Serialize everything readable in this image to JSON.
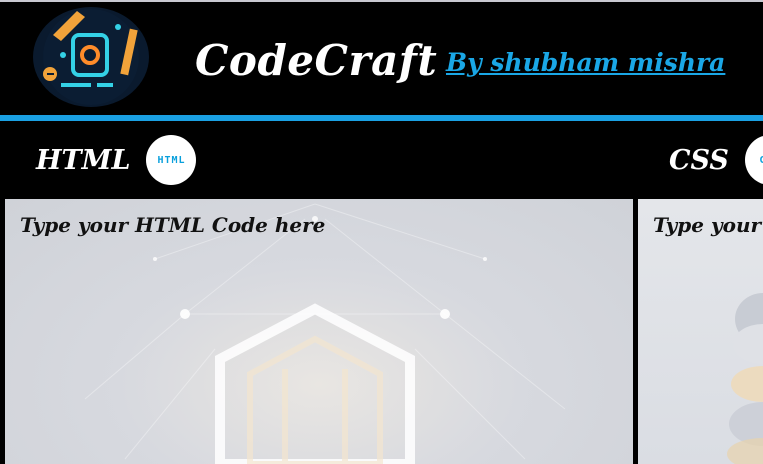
{
  "header": {
    "brand": "CodeCraft",
    "byline": "By shubham mishra"
  },
  "panels": {
    "html": {
      "label": "HTML",
      "badge": "HTML",
      "placeholder": "Type your HTML Code here"
    },
    "css": {
      "label": "CSS",
      "badge": "CSS",
      "placeholder": "Type your"
    }
  },
  "colors": {
    "accent": "#1aa0e2",
    "byline": "#1aa7e6",
    "background": "#000000"
  }
}
